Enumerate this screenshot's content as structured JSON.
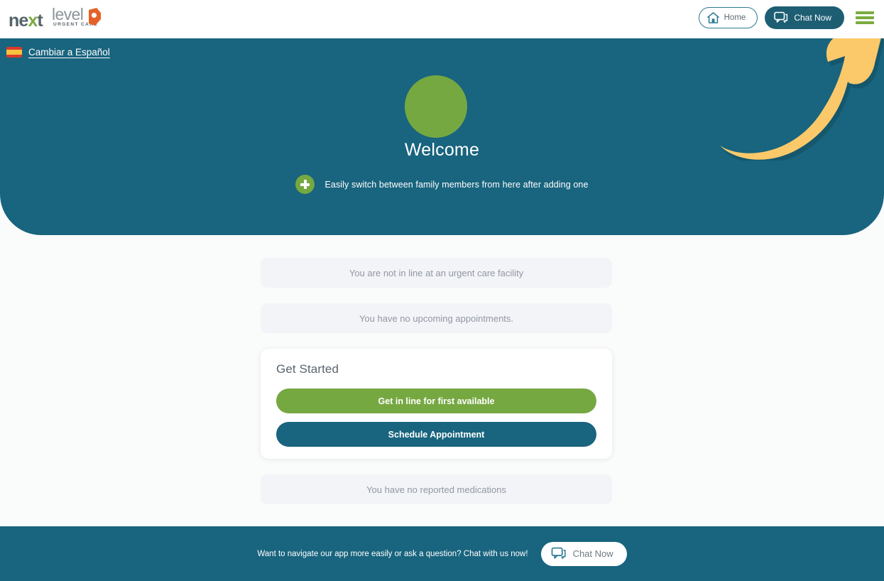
{
  "brand": {
    "logo_next": "next",
    "logo_x": "x",
    "logo_next_tail": "t",
    "logo_level": "level",
    "logo_tagline": "URGENT CARE",
    "teal": "#19647E",
    "green": "#76A842",
    "orange": "#E4622A",
    "arrow_yellow": "#FBC96A"
  },
  "topbar": {
    "home_label": "Home",
    "chat_label": "Chat Now",
    "home_icon": "house-icon",
    "chat_icon": "chat-bubble-icon",
    "menu_icon": "hamburger-menu-icon"
  },
  "hero": {
    "language_link": "Cambiar a Español",
    "flag_icon": "spain-flag-icon",
    "avatar_icon": "user-avatar-placeholder",
    "welcome": "Welcome",
    "add_icon": "plus-circle-icon",
    "switch_hint": "Easily switch between family members from here after adding one",
    "annotation_icon": "curved-arrow-up-right-icon"
  },
  "main": {
    "line_status": "You are not in line at an urgent care facility",
    "appointments_status": "You have no upcoming appointments.",
    "medications_status": "You have no reported medications",
    "get_started": {
      "title": "Get Started",
      "primary_button": "Get in line for first available",
      "secondary_button": "Schedule Appointment"
    }
  },
  "footer": {
    "prompt": "Want to navigate our app more easily or ask a question? Chat with us now!",
    "chat_label": "Chat Now",
    "chat_icon": "chat-bubble-icon"
  }
}
